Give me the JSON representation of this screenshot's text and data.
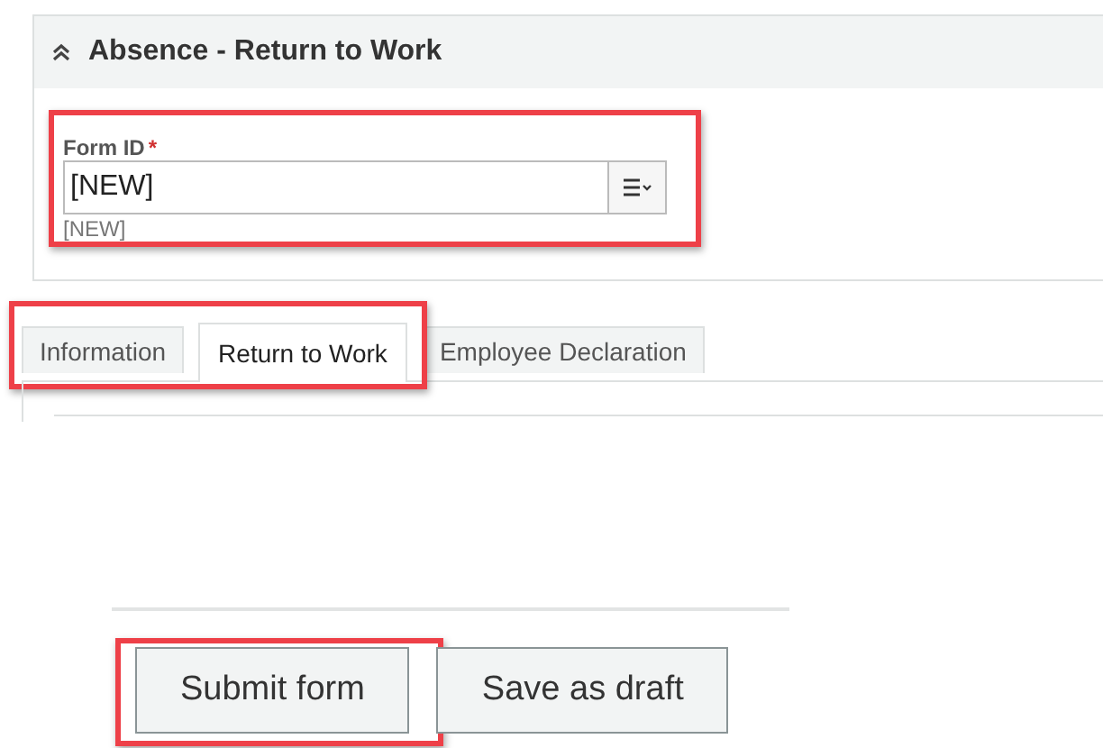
{
  "section": {
    "title": "Absence - Return to Work",
    "expanded": true
  },
  "form_id": {
    "label": "Form ID",
    "required_mark": "*",
    "value": "[NEW]",
    "hint": "[NEW]"
  },
  "tabs": [
    {
      "label": "Information",
      "selected": false
    },
    {
      "label": "Return to Work",
      "selected": true
    },
    {
      "label": "Employee Declaration",
      "selected": false
    }
  ],
  "buttons": [
    {
      "label": "Submit form",
      "highlighted": true
    },
    {
      "label": "Save as draft",
      "highlighted": false
    }
  ]
}
